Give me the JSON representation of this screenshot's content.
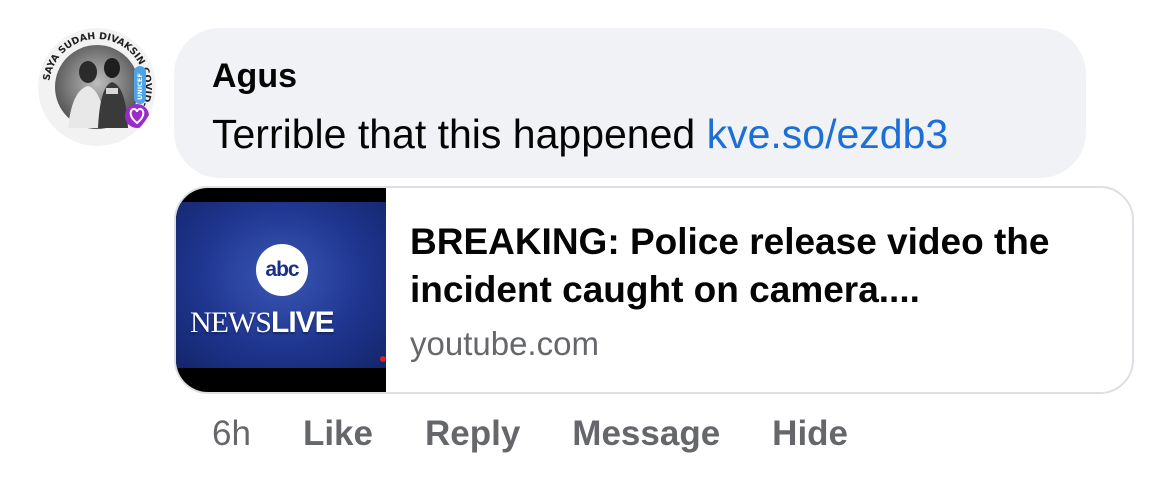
{
  "comment": {
    "author": "Agus",
    "text": "Terrible that this happened ",
    "link_text": "kve.so/ezdb3",
    "avatar_badge_text": "SAYA SUDAH DIVAKSIN COVID-19",
    "avatar_side_text": "UNICEF"
  },
  "link_preview": {
    "thumbnail": {
      "logo_text": "abc",
      "news_text": "NEWS",
      "live_text": "LIVE"
    },
    "title": "BREAKING: Police release video the incident caught on camera....",
    "domain": "youtube.com"
  },
  "actions": {
    "time": "6h",
    "like": "Like",
    "reply": "Reply",
    "message": "Message",
    "hide": "Hide"
  },
  "colors": {
    "bubble_bg": "#f0f2f5",
    "link": "#1b6fd6",
    "secondary_text": "#65676b",
    "primary_text": "#050505"
  }
}
